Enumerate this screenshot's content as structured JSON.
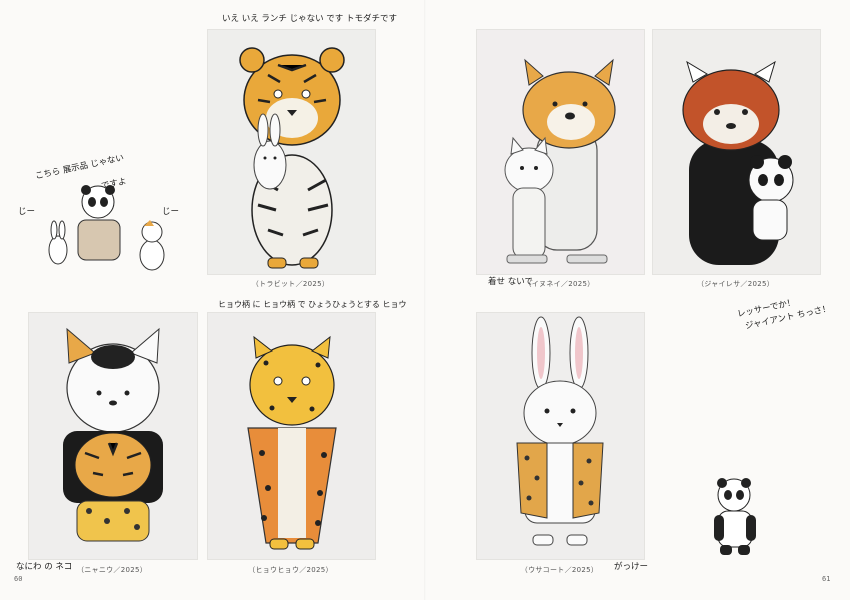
{
  "pages": {
    "left_folio": "60",
    "right_folio": "61"
  },
  "artworks": [
    {
      "id": "torabitto",
      "caption": "（トラビット／2025）"
    },
    {
      "id": "inuneko",
      "caption": "（イヌネイ／2025）"
    },
    {
      "id": "jaiantopanda",
      "caption": "（ジャイレサ／2025）"
    },
    {
      "id": "nyanitora",
      "caption": "（ニャニウ／2025）"
    },
    {
      "id": "hyouhyou",
      "caption": "（ヒョウヒョウ／2025）"
    },
    {
      "id": "usacoat",
      "caption": "（ウサコート／2025）"
    }
  ],
  "notes": {
    "top_tiger": "いえ いえ ランチ じゃない です トモダチです",
    "panda_exhibit_line1": "こちら 展示品 じゃない",
    "panda_exhibit_line2": "ですよ",
    "ji_left": "じー",
    "ji_right": "じー",
    "leopard": "ヒョウ柄 に ヒョウ柄 で ひょうひょうとする ヒョウ",
    "dog_cat": "着せ ないで",
    "redpanda_line1": "レッサーでか！",
    "redpanda_line2": "ジャイアント ちっさ！",
    "nyanitora": "なにわ の ネコ",
    "gakkari": "がっけー"
  }
}
